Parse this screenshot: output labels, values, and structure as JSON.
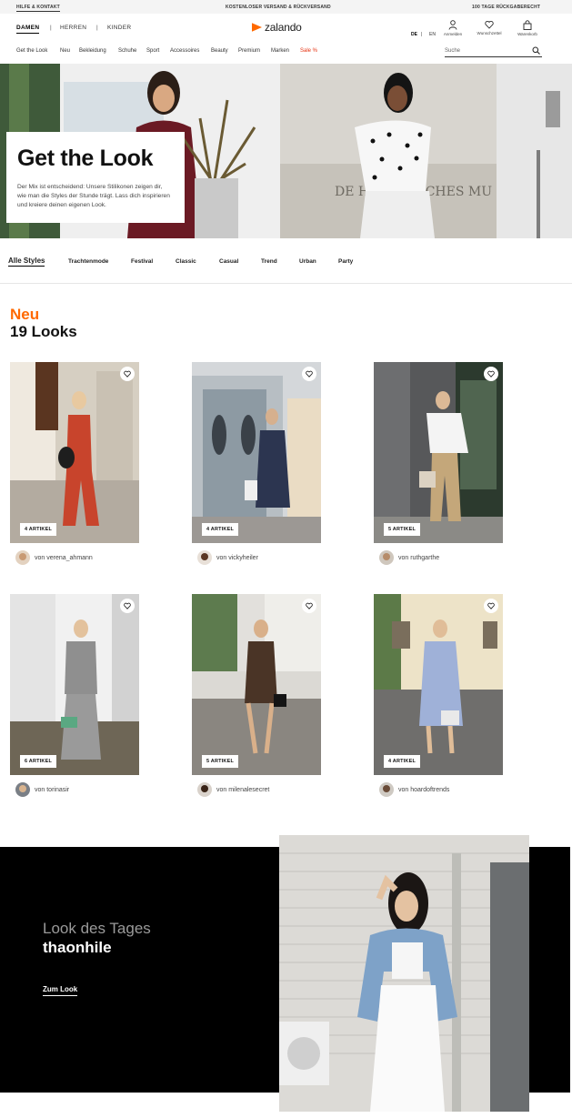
{
  "topbar": {
    "help": "HILFE & KONTAKT",
    "shipping": "KOSTENLOSER VERSAND & RÜCKVERSAND",
    "returns": "100 TAGE RÜCKGABERECHT"
  },
  "header": {
    "gender_tabs": [
      "DAMEN",
      "HERREN",
      "KINDER"
    ],
    "separator": "|",
    "logo_text": "zalando",
    "languages": [
      "DE",
      "EN"
    ],
    "icons": [
      {
        "label": "Anmelden",
        "icon": "user-icon"
      },
      {
        "label": "Wunschzettel",
        "icon": "heart-icon"
      },
      {
        "label": "Warenkorb",
        "icon": "bag-icon"
      }
    ],
    "categories": [
      "Get the Look",
      "Neu",
      "Bekleidung",
      "Schuhe",
      "Sport",
      "Accessoires",
      "Beauty",
      "Premium",
      "Marken",
      "Sale %"
    ],
    "search_placeholder": "Suche"
  },
  "hero": {
    "title": "Get the Look",
    "description": "Der Mix ist entscheidend: Unsere Stilikonen zeigen dir, wie man die Styles der Stunde trägt. Lass dich inspirieren und kreiere deinen eigenen Look."
  },
  "style_tabs": [
    "Alle Styles",
    "Trachtenmode",
    "Festival",
    "Classic",
    "Casual",
    "Trend",
    "Urban",
    "Party"
  ],
  "section": {
    "kicker": "Neu",
    "count": "19 Looks"
  },
  "looks": [
    {
      "badge": "4 ARTIKEL",
      "author": "von verena_ahmann",
      "outfit": "#c8442c"
    },
    {
      "badge": "4 ARTIKEL",
      "author": "von vickyheiler",
      "outfit": "#2c3550"
    },
    {
      "badge": "5 ARTIKEL",
      "author": "von ruthgarthe",
      "outfit": "#c4a77a"
    },
    {
      "badge": "6 ARTIKEL",
      "author": "von torinasir",
      "outfit": "#8f8f8f"
    },
    {
      "badge": "5 ARTIKEL",
      "author": "von milenalesecret",
      "outfit": "#4a3426"
    },
    {
      "badge": "4 ARTIKEL",
      "author": "von hoardoftrends",
      "outfit": "#9fb1d8"
    }
  ],
  "look_of_day": {
    "kicker": "Look des Tages",
    "name": "thaonhile",
    "link": "Zum Look"
  },
  "colors": {
    "brand_orange": "#ff6900",
    "sale_red": "#e63312",
    "banner_black": "#000000"
  }
}
